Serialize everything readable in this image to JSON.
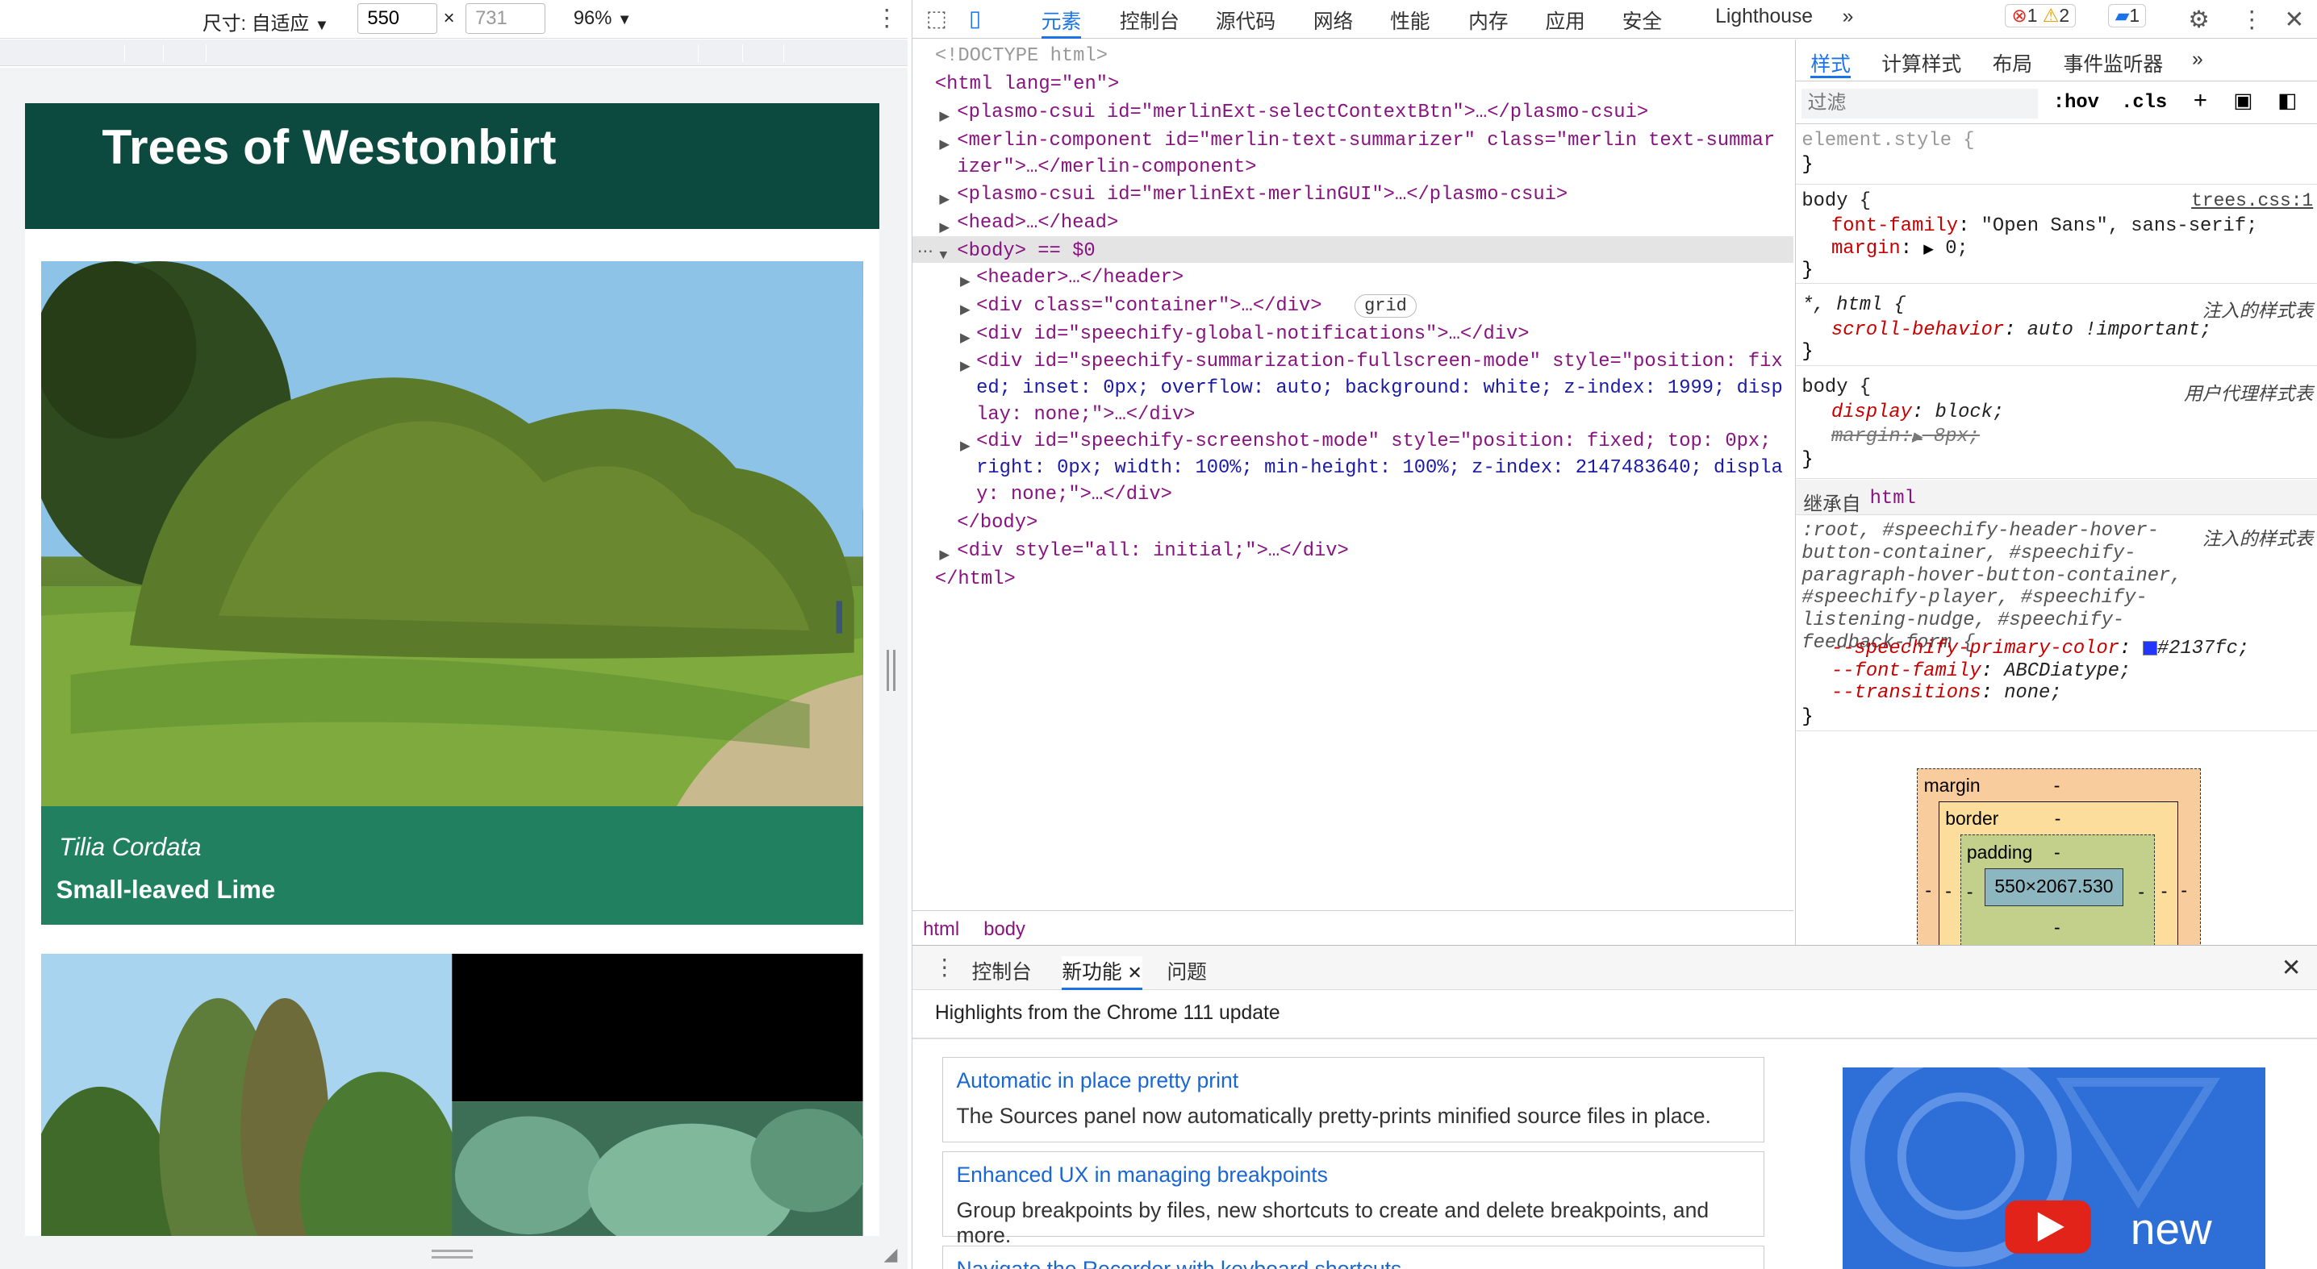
{
  "device_toolbar": {
    "dimensions_label": "尺寸: 自适应",
    "width": "550",
    "height": "731",
    "times": "×",
    "zoom": "96%"
  },
  "page": {
    "title": "Trees of Westonbirt",
    "card1": {
      "latin": "Tilia Cordata",
      "common": "Small-leaved Lime"
    }
  },
  "devtools": {
    "tabs": [
      "元素",
      "控制台",
      "源代码",
      "网络",
      "性能",
      "内存",
      "应用",
      "安全",
      "Lighthouse"
    ],
    "badges": {
      "errors": "1",
      "warnings": "2",
      "messages": "1"
    },
    "dom_lines": [
      {
        "text": "<!DOCTYPE html>"
      },
      {
        "text": "<html lang=\"en\">"
      },
      {
        "text": "<plasmo-csui id=\"merlinExt-selectContextBtn\">…</plasmo-csui>"
      },
      {
        "text": "<merlin-component id=\"merlin-text-summarizer\" class=\"merlin text-summar"
      },
      {
        "text": "izer\">…</merlin-component>"
      },
      {
        "text": "<plasmo-csui id=\"merlinExt-merlinGUI\">…</plasmo-csui>"
      },
      {
        "text": "<head>…</head>"
      },
      {
        "text": "<body> == $0"
      },
      {
        "text": "<header>…</header>"
      },
      {
        "text": "<div class=\"container\">…</div>"
      },
      {
        "text": "<div id=\"speechify-global-notifications\">…</div>"
      },
      {
        "text": "<div id=\"speechify-summarization-fullscreen-mode\" style=\"position: fix"
      },
      {
        "text": "ed; inset: 0px; overflow: auto; background: white; z-index: 1999; disp"
      },
      {
        "text": "lay: none;\">…</div>"
      },
      {
        "text": "<div id=\"speechify-screenshot-mode\" style=\"position: fixed; top: 0px;"
      },
      {
        "text": "right: 0px; width: 100%; min-height: 100%; z-index: 2147483640; displa"
      },
      {
        "text": "y: none;\">…</div>"
      },
      {
        "text": "</body>"
      },
      {
        "text": "<div style=\"all: initial;\">…</div>"
      },
      {
        "text": "</html>"
      }
    ],
    "grid_badge": "grid",
    "breadcrumbs": [
      "html",
      "body"
    ],
    "styles_tabs": [
      "样式",
      "计算样式",
      "布局",
      "事件监听器"
    ],
    "filter_placeholder": "过滤",
    "hov": ":hov",
    "cls": ".cls",
    "rules": {
      "element_style": "element.style {",
      "body1_sel": "body {",
      "body1_src": "trees.css:1",
      "body1_p1": "font-family",
      "body1_v1": "\"Open Sans\", sans-serif;",
      "body1_p2": "margin",
      "body1_v2": "0;",
      "star_sel": "*, html {",
      "star_src": "注入的样式表",
      "star_p": "scroll-behavior",
      "star_v": "auto !important;",
      "body2_sel": "body {",
      "body2_src": "用户代理样式表",
      "body2_p1": "display",
      "body2_v1": "block;",
      "body2_p2": "margin",
      "body2_v2": "8px;",
      "inherit_label": "继承自",
      "inherit_tag": "html",
      "root_sel": ":root, #speechify-header-hover-button-container, #speechify-paragraph-hover-button-container, #speechify-player, #speechify-listening-nudge, #speechify-feedback-form {",
      "root_src": "注入的样式表",
      "root_p1": "--speechify-primary-color",
      "root_v1": "#2137fc;",
      "root_p2": "--font-family",
      "root_v2": "ABCDiatype;",
      "root_p3": "--transitions",
      "root_v3": "none;",
      "close": "}"
    },
    "boxmodel": {
      "margin": "margin",
      "border": "border",
      "padding": "padding",
      "content": "550×2067.530",
      "dash": "-"
    },
    "drawer": {
      "tabs": [
        "控制台",
        "新功能",
        "问题"
      ],
      "heading": "Highlights from the Chrome 111 update",
      "features": [
        {
          "title": "Automatic in place pretty print",
          "desc": "The Sources panel now automatically pretty-prints minified source files in place."
        },
        {
          "title": "Enhanced UX in managing breakpoints",
          "desc": "Group breakpoints by files, new shortcuts to create and delete breakpoints, and more."
        },
        {
          "title": "Navigate the Recorder with keyboard shortcuts",
          "desc": ""
        }
      ],
      "promo_text": "new"
    }
  },
  "colors": {
    "header": "#0c4a3f",
    "caption": "#21805f",
    "accent": "#1967d2",
    "speechify_primary": "#2137fc"
  }
}
